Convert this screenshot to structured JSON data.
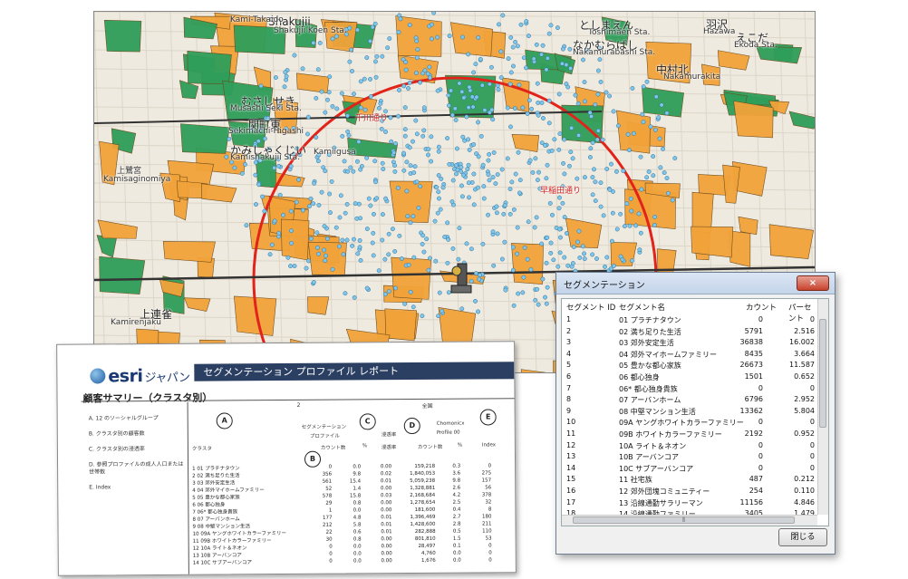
{
  "map": {
    "labels": [
      {
        "t": "Shakujii",
        "c": "big"
      },
      {
        "t": "Shakujii Koen Sta.",
        "c": ""
      },
      {
        "t": "むさしせき",
        "c": "big"
      },
      {
        "t": "Musashi Seki Sta.",
        "c": ""
      },
      {
        "t": "関町東",
        "c": "big"
      },
      {
        "t": "Sekimachi-Higashi",
        "c": ""
      },
      {
        "t": "かみしゃくじい",
        "c": "big"
      },
      {
        "t": "Kamishakujii Sta.",
        "c": ""
      },
      {
        "t": "Kamiigusa",
        "c": ""
      },
      {
        "t": "千川通り",
        "c": "red"
      },
      {
        "t": "早稲田通り",
        "c": "red"
      },
      {
        "t": "としまえん",
        "c": "big"
      },
      {
        "t": "Toshimaen Sta.",
        "c": ""
      },
      {
        "t": "なかむらばし",
        "c": "big"
      },
      {
        "t": "Nakamurabashi Sta.",
        "c": ""
      },
      {
        "t": "中村北",
        "c": "big"
      },
      {
        "t": "Nakamurakita",
        "c": ""
      },
      {
        "t": "羽沢",
        "c": "big"
      },
      {
        "t": "Hazawa",
        "c": ""
      },
      {
        "t": "えこだ",
        "c": "big"
      },
      {
        "t": "Ekoda Sta.",
        "c": ""
      },
      {
        "t": "上鷺宮",
        "c": ""
      },
      {
        "t": "Kamisaginomiya",
        "c": ""
      },
      {
        "t": "Kamirenjaku",
        "c": ""
      },
      {
        "t": "上連雀",
        "c": "big"
      },
      {
        "t": "Kami-Takaido",
        "c": ""
      }
    ]
  },
  "report": {
    "logo": "esri",
    "logo_jp": "ジャパン",
    "title": "セグメンテーション プロファイル レポート",
    "heading": "顧客サマリー（クラスタ別）",
    "col2": "2",
    "col_all": "全国",
    "legend": [
      "A. 12 のソーシャルグループ",
      "B. クラスタ別の顧客数",
      "C. クラスタ別の浸透率",
      "D. 参照プロファイルの成人人口または世帯数",
      "E. Index"
    ],
    "circles": [
      "A",
      "B",
      "C",
      "D",
      "E"
    ],
    "hdr": {
      "segprof": "セグメンテーション",
      "segprof2": "プロファイル",
      "penetration": "浸透率",
      "chomonicx": "Chomonicx",
      "profile00": "Profile 00",
      "cluster": "クラスタ",
      "count": "カウント数",
      "pct": "%",
      "pen2": "浸透率",
      "count2": "カウント数",
      "pct2": "%",
      "index": "Index"
    },
    "rows": [
      [
        "1 01 プラチナタウン",
        "0",
        "0.0",
        "0.00",
        "159,218",
        "0.3",
        "0"
      ],
      [
        "2 02 満ち足りた生活",
        "356",
        "9.8",
        "0.02",
        "1,840,053",
        "3.6",
        "275"
      ],
      [
        "3 03 郊外安定生活",
        "561",
        "15.4",
        "0.01",
        "5,059,238",
        "9.8",
        "157"
      ],
      [
        "4 04 郊外マイホームファミリー",
        "52",
        "1.4",
        "0.00",
        "1,328,881",
        "2.6",
        "56"
      ],
      [
        "5 05 豊かな都心家族",
        "578",
        "15.8",
        "0.03",
        "2,168,684",
        "4.2",
        "378"
      ],
      [
        "6 06 都心独身",
        "29",
        "0.8",
        "0.00",
        "1,278,654",
        "2.5",
        "32"
      ],
      [
        "7 06* 都心独身貴族",
        "1",
        "0.0",
        "0.00",
        "181,600",
        "0.4",
        "8"
      ],
      [
        "8 07 アーバンホーム",
        "177",
        "4.8",
        "0.01",
        "1,396,469",
        "2.7",
        "180"
      ],
      [
        "9 08 中堅マンション生活",
        "212",
        "5.8",
        "0.01",
        "1,428,600",
        "2.8",
        "211"
      ],
      [
        "10 09A ヤングホワイトカラーファミリー",
        "22",
        "0.6",
        "0.01",
        "282,888",
        "0.5",
        "110"
      ],
      [
        "11 09B ホワイトカラーファミリー",
        "30",
        "0.8",
        "0.00",
        "801,810",
        "1.5",
        "53"
      ],
      [
        "12 10A ライト＆ネオン",
        "0",
        "0.0",
        "0.00",
        "28,497",
        "0.1",
        "0"
      ],
      [
        "13 10B アーバンコア",
        "0",
        "0.0",
        "0.00",
        "4,760",
        "0.0",
        "0"
      ],
      [
        "14 10C サブアーバンコア",
        "0",
        "0.0",
        "0.00",
        "1,676",
        "0.0",
        "0"
      ]
    ]
  },
  "dialog": {
    "title": "セグメンテーション",
    "close_glyph": "×",
    "headers": [
      "セグメント ID",
      "セグメント名",
      "カウント",
      "パーセント"
    ],
    "rows": [
      [
        "1",
        "01 プラチナタウン",
        "0",
        "0"
      ],
      [
        "2",
        "02 満ち足りた生活",
        "5791",
        "2.516"
      ],
      [
        "3",
        "03 郊外安定生活",
        "36838",
        "16.002"
      ],
      [
        "4",
        "04 郊外マイホームファミリー",
        "8435",
        "3.664"
      ],
      [
        "5",
        "05 豊かな都心家族",
        "26673",
        "11.587"
      ],
      [
        "6",
        "06 都心独身",
        "1501",
        "0.652"
      ],
      [
        "7",
        "06* 都心独身貴族",
        "0",
        "0"
      ],
      [
        "8",
        "07 アーバンホーム",
        "6796",
        "2.952"
      ],
      [
        "9",
        "08 中堅マンション生活",
        "13362",
        "5.804"
      ],
      [
        "10",
        "09A ヤングホワイトカラーファミリー",
        "0",
        "0"
      ],
      [
        "11",
        "09B ホワイトカラーファミリー",
        "2192",
        "0.952"
      ],
      [
        "12",
        "10A ライト＆ネオン",
        "0",
        "0"
      ],
      [
        "13",
        "10B アーバンコア",
        "0",
        "0"
      ],
      [
        "14",
        "10C サブアーバンコア",
        "0",
        "0"
      ],
      [
        "15",
        "11 社宅族",
        "487",
        "0.212"
      ],
      [
        "16",
        "12 郊外団塊コミュニティー",
        "254",
        "0.110"
      ],
      [
        "17",
        "13 沿線通勤サラリーマン",
        "11156",
        "4.846"
      ],
      [
        "18",
        "14 沿線通勤ファミリー",
        "3405",
        "1.479"
      ]
    ],
    "ok_label": "閉じる",
    "hscroll_glyph": "⦀"
  }
}
